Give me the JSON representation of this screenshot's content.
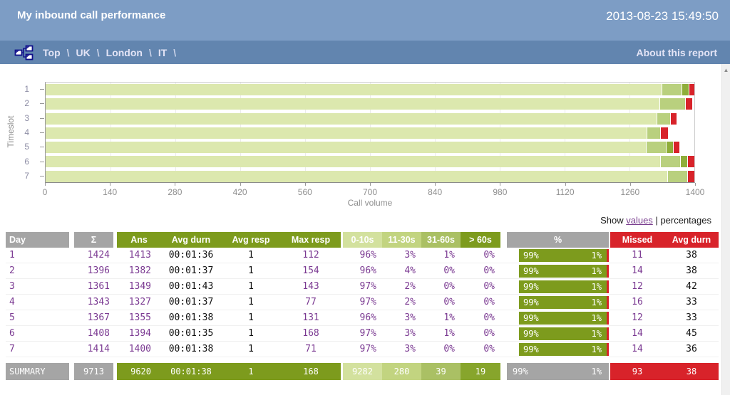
{
  "header": {
    "title": "My inbound call performance",
    "timestamp": "2013-08-23 15:49:50"
  },
  "breadcrumb": {
    "icon": "sitemap-icon",
    "crumbs": [
      "Top",
      "UK",
      "London",
      "IT"
    ],
    "separator": "\\",
    "about_link": "About this report"
  },
  "chart_data": {
    "type": "bar",
    "orientation": "horizontal",
    "stacked": true,
    "title": "",
    "ylabel": "Timeslot",
    "xlabel": "Call volume",
    "categories": [
      "1",
      "2",
      "3",
      "4",
      "5",
      "6",
      "7"
    ],
    "xlim": [
      0,
      1400
    ],
    "xticks": [
      0,
      140,
      280,
      420,
      560,
      700,
      840,
      980,
      1120,
      1260,
      1400
    ],
    "grid": true,
    "series": [
      {
        "name": "0-10s",
        "color": "#dce8ae",
        "values": [
          1357,
          1327,
          1322,
          1300,
          1300,
          1338,
          1358
        ]
      },
      {
        "name": "11-30s",
        "color": "#b9d07e",
        "values": [
          42,
          55,
          27,
          27,
          41,
          42,
          42
        ]
      },
      {
        "name": "31-60s",
        "color": "#8fae3a",
        "values": [
          14,
          0,
          0,
          0,
          14,
          14,
          0
        ]
      },
      {
        "name": ">60s",
        "color": "#7d9b1d",
        "values": [
          0,
          0,
          0,
          0,
          0,
          0,
          0
        ]
      },
      {
        "name": "Missed",
        "color": "#d8232a",
        "values": [
          11,
          14,
          12,
          16,
          12,
          14,
          14
        ]
      }
    ]
  },
  "show_toggle": {
    "prefix": "Show",
    "values_link": "values",
    "divider": "|",
    "percentages_label": "percentages"
  },
  "table": {
    "headers": {
      "day": "Day",
      "sum": "Σ",
      "ans": "Ans",
      "avg_durn": "Avg durn",
      "avg_resp": "Avg resp",
      "max_resp": "Max resp",
      "s0": "0-10s",
      "s1": "11-30s",
      "s2": "31-60s",
      "s3": "> 60s",
      "pct": "%",
      "missed": "Missed",
      "missed_avg_durn": "Avg durn"
    },
    "rows": [
      {
        "day": "1",
        "sum": "1424",
        "ans": "1413",
        "avg_durn": "00:01:36",
        "avg_resp": "1",
        "max_resp": "112",
        "s0": "96%",
        "s1": "3%",
        "s2": "1%",
        "s3": "0%",
        "pct_ans": "99%",
        "pct_missed": "1%",
        "missed": "11",
        "missed_avg_durn": "38"
      },
      {
        "day": "2",
        "sum": "1396",
        "ans": "1382",
        "avg_durn": "00:01:37",
        "avg_resp": "1",
        "max_resp": "154",
        "s0": "96%",
        "s1": "4%",
        "s2": "0%",
        "s3": "0%",
        "pct_ans": "99%",
        "pct_missed": "1%",
        "missed": "14",
        "missed_avg_durn": "38"
      },
      {
        "day": "3",
        "sum": "1361",
        "ans": "1349",
        "avg_durn": "00:01:43",
        "avg_resp": "1",
        "max_resp": "143",
        "s0": "97%",
        "s1": "2%",
        "s2": "0%",
        "s3": "0%",
        "pct_ans": "99%",
        "pct_missed": "1%",
        "missed": "12",
        "missed_avg_durn": "42"
      },
      {
        "day": "4",
        "sum": "1343",
        "ans": "1327",
        "avg_durn": "00:01:37",
        "avg_resp": "1",
        "max_resp": "77",
        "s0": "97%",
        "s1": "2%",
        "s2": "0%",
        "s3": "0%",
        "pct_ans": "99%",
        "pct_missed": "1%",
        "missed": "16",
        "missed_avg_durn": "33"
      },
      {
        "day": "5",
        "sum": "1367",
        "ans": "1355",
        "avg_durn": "00:01:38",
        "avg_resp": "1",
        "max_resp": "131",
        "s0": "96%",
        "s1": "3%",
        "s2": "1%",
        "s3": "0%",
        "pct_ans": "99%",
        "pct_missed": "1%",
        "missed": "12",
        "missed_avg_durn": "33"
      },
      {
        "day": "6",
        "sum": "1408",
        "ans": "1394",
        "avg_durn": "00:01:35",
        "avg_resp": "1",
        "max_resp": "168",
        "s0": "97%",
        "s1": "3%",
        "s2": "1%",
        "s3": "0%",
        "pct_ans": "99%",
        "pct_missed": "1%",
        "missed": "14",
        "missed_avg_durn": "45"
      },
      {
        "day": "7",
        "sum": "1414",
        "ans": "1400",
        "avg_durn": "00:01:38",
        "avg_resp": "1",
        "max_resp": "71",
        "s0": "97%",
        "s1": "3%",
        "s2": "0%",
        "s3": "0%",
        "pct_ans": "99%",
        "pct_missed": "1%",
        "missed": "14",
        "missed_avg_durn": "36"
      }
    ],
    "summary": {
      "day": "SUMMARY",
      "sum": "9713",
      "ans": "9620",
      "avg_durn": "00:01:38",
      "avg_resp": "1",
      "max_resp": "168",
      "s0": "9282",
      "s1": "280",
      "s2": "39",
      "s3": "19",
      "pct_ans": "99%",
      "pct_missed": "1%",
      "missed": "93",
      "missed_avg_durn": "38"
    }
  },
  "scrollbar": {
    "up_arrow": "▲"
  },
  "colors": {
    "titlebar": "#7d9dc5",
    "breadcrumb_bar": "#6285af",
    "header_gray": "#a5a5a5",
    "accent_olive": "#7d9b1d",
    "accent_red": "#d8232a",
    "link_purple": "#7b3a92",
    "band_colors": [
      "#d3e19e",
      "#c2d480",
      "#aac064",
      "#7d9b1d"
    ],
    "chart_pale_green": "#dce8ae",
    "chart_mid_green": "#b9d07e",
    "chart_dark_green": "#8fae3a"
  }
}
